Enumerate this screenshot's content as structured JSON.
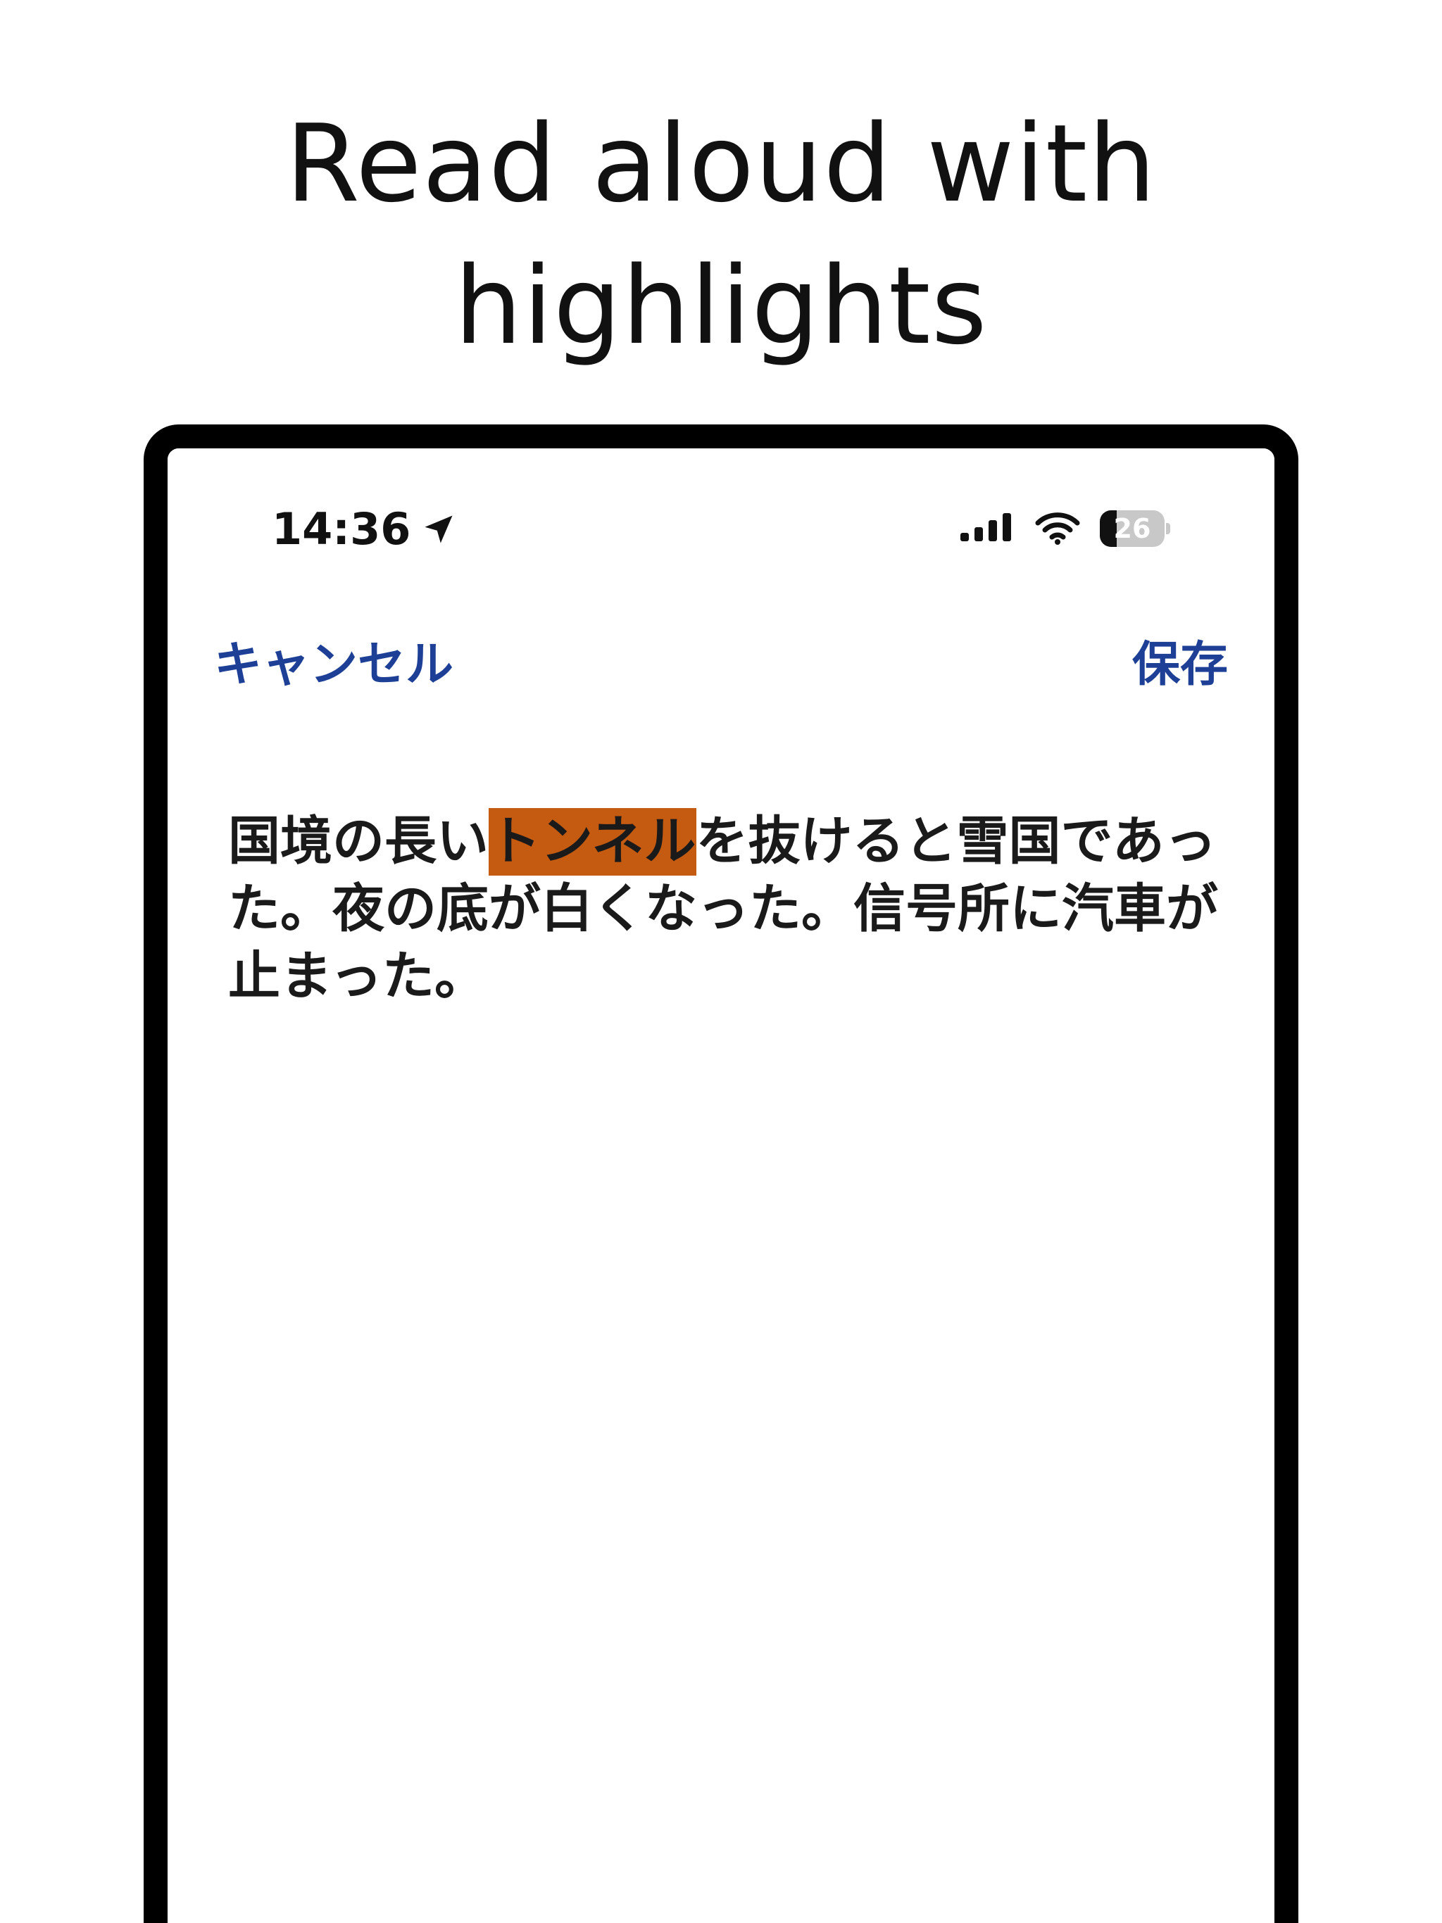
{
  "headline": {
    "line1": "Read aloud with",
    "line2": "highlights"
  },
  "status_bar": {
    "time": "14:36",
    "location_icon": "location-arrow-icon",
    "signal_icon": "cellular-signal-icon",
    "wifi_icon": "wifi-icon",
    "battery_level": "26",
    "battery_fraction": 0.26
  },
  "nav": {
    "cancel_label": "キャンセル",
    "save_label": "保存"
  },
  "reader": {
    "text_before": "国境の長い",
    "highlighted": "トンネル",
    "text_after": "を抜けると雪国であった。夜の底が白くなった。信号所に汽車が止まった。"
  },
  "colors": {
    "nav_link": "#1d3f96",
    "highlight": "#c55a11",
    "frame": "#000000"
  }
}
